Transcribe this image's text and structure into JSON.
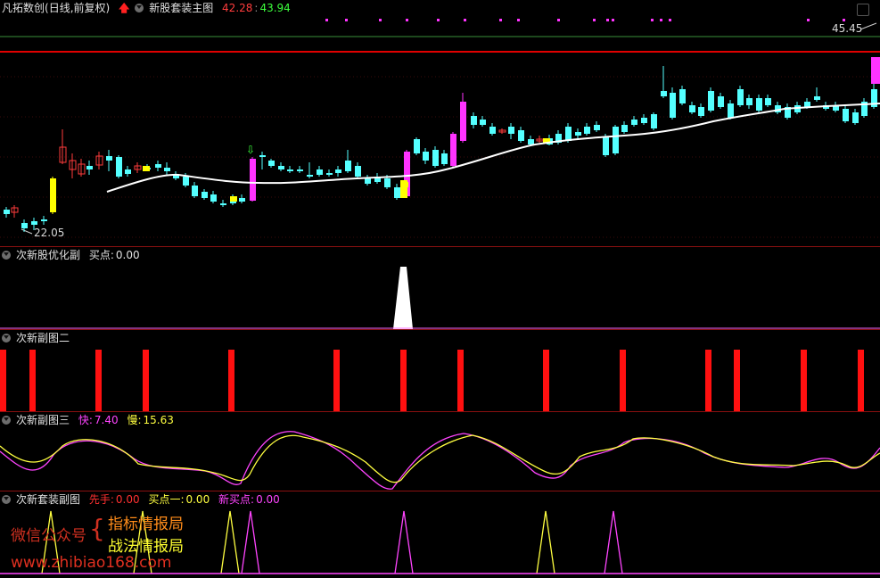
{
  "main_panel": {
    "stock_name": "凡拓数创",
    "period": "(日线,前复权)",
    "indicator_name": "新股套装主图",
    "value_red": "42.28",
    "value_green": "43.94",
    "price_high_label": "45.45",
    "price_low_label": "22.05"
  },
  "sub1": {
    "name": "次新股优化副",
    "buy_label": "买点:",
    "buy_value": "0.00"
  },
  "sub2": {
    "name": "次新副图二"
  },
  "sub3": {
    "name": "次新副图三",
    "fast_label": "快:",
    "fast_value": "7.40",
    "slow_label": "慢:",
    "slow_value": "15.63"
  },
  "sub4": {
    "name": "次新套装副图",
    "hand_label": "先手:",
    "hand_value": "0.00",
    "buy1_label": "买点一:",
    "buy1_value": "0.00",
    "newbuy_label": "新买点:",
    "newbuy_value": "0.00"
  },
  "watermark": {
    "wechat": "微信公众号",
    "line1": "指标情报局",
    "line2": "战法情报局",
    "url": "www.zhibiao168.com"
  },
  "colors": {
    "up": "#ff3c3c",
    "down": "#54ffff",
    "magenta": "#ff33ff",
    "yellow": "#ffff00",
    "ma": "#ffffff",
    "green_line": "#3a8f3a",
    "red_line": "#e00000"
  }
}
